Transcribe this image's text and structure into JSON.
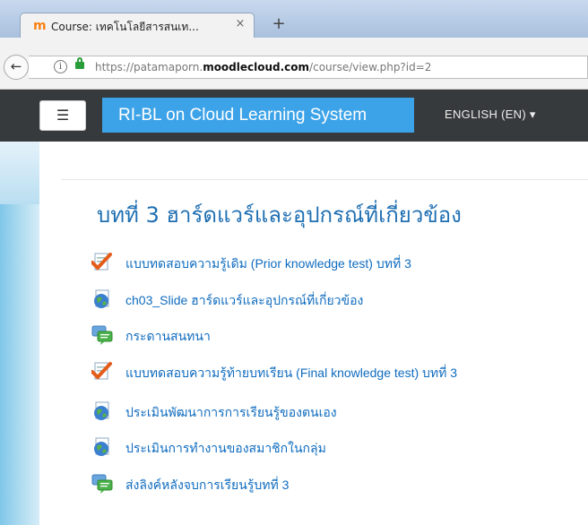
{
  "browser": {
    "tab_title": "Course: เทคโนโลยีสารสนเท...",
    "tab_close": "×",
    "new_tab": "+",
    "url_prefix": "https://patamaporn.",
    "url_host": "moodlecloud.com",
    "url_path": "/course/view.php?id=2"
  },
  "navbar": {
    "menu_icon": "☰",
    "brand": "RI-BL on Cloud Learning System",
    "language": "ENGLISH (EN) ▾"
  },
  "section": {
    "title": "บทที่ 3 ฮาร์ดแวร์และอุปกรณ์ที่เกี่ยวข้อง",
    "activities": [
      {
        "type": "quiz",
        "icon": "quiz-checkmark-icon",
        "label": "แบบทดสอบความรู้เดิม (Prior knowledge test) บทที่ 3"
      },
      {
        "type": "url",
        "icon": "globe-icon",
        "label": "ch03_Slide ฮาร์ดแวร์และอุปกรณ์ที่เกี่ยวข้อง"
      },
      {
        "type": "forum",
        "icon": "forum-icon",
        "label": "กระดานสนทนา"
      },
      {
        "type": "quiz",
        "icon": "quiz-checkmark-icon",
        "label": "แบบทดสอบความรู้ท้ายบทเรียน (Final knowledge test) บทที่ 3"
      },
      {
        "type": "url",
        "icon": "globe-icon",
        "label": "ประเมินพัฒนาการการเรียนรู้ของตนเอง"
      },
      {
        "type": "url",
        "icon": "globe-icon",
        "label": "ประเมินการทำงานของสมาชิกในกลุ่ม"
      },
      {
        "type": "forum",
        "icon": "forum-icon",
        "label": "ส่งลิงค์หลังจบการเรียนรู้บทที่ 3"
      }
    ]
  },
  "colors": {
    "brand_bg": "#3da3e8",
    "navbar_bg": "#373a3c",
    "link": "#0f6cbf",
    "title": "#1f6fb2"
  }
}
